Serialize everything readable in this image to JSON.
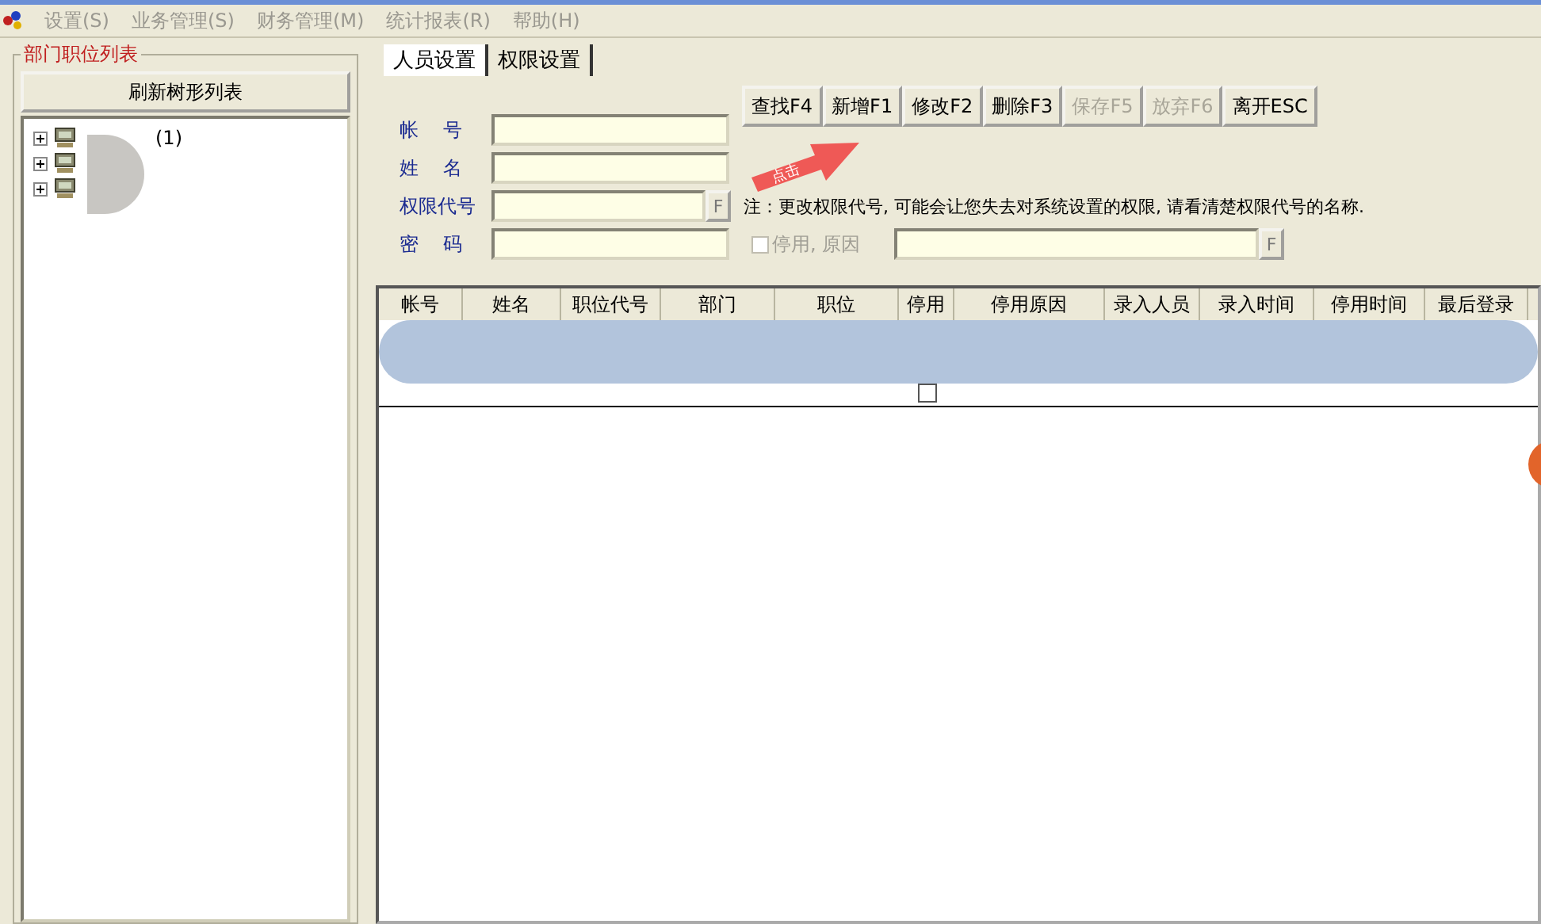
{
  "menu": [
    "设置(S)",
    "业务管理(S)",
    "财务管理(M)",
    "统计报表(R)",
    "帮助(H)"
  ],
  "left_panel": {
    "title": "部门职位列表",
    "refresh_button": "刷新树形列表",
    "tree": [
      {
        "label": "(1)",
        "expanded": false
      },
      {
        "expanded": false
      },
      {
        "expanded": false
      }
    ]
  },
  "tabs": [
    {
      "label": "人员设置",
      "selected": true
    },
    {
      "label": "权限设置",
      "selected": false
    }
  ],
  "form": {
    "fields": [
      {
        "label": "帐    号",
        "kind": "text"
      },
      {
        "label": "姓    名",
        "kind": "text"
      },
      {
        "label": "权限代号",
        "kind": "lookup",
        "lookup_button": "F"
      },
      {
        "label": "密    码",
        "kind": "text"
      }
    ],
    "note": "注：更改权限代号, 可能会让您失去对系统设置的权限, 请看清楚权限代号的名称.",
    "disable_option": {
      "label": "停用, 原因",
      "checked": false,
      "disabled": true
    },
    "reason_lookup_button": "F"
  },
  "buttons": [
    {
      "label": "查找F4",
      "disabled": false
    },
    {
      "label": "新增F1",
      "disabled": false
    },
    {
      "label": "修改F2",
      "disabled": false
    },
    {
      "label": "删除F3",
      "disabled": false
    },
    {
      "label": "保存F5",
      "disabled": true
    },
    {
      "label": "放弃F6",
      "disabled": true
    },
    {
      "label": "离开ESC",
      "disabled": false
    }
  ],
  "table": {
    "columns": [
      "帐号",
      "姓名",
      "职位代号",
      "部门",
      "职位",
      "停用",
      "停用原因",
      "录入人员",
      "录入时间",
      "停用时间",
      "最后登录"
    ],
    "rows": [
      {
        "stopped": false
      }
    ]
  },
  "annotation": {
    "label": "点击"
  }
}
